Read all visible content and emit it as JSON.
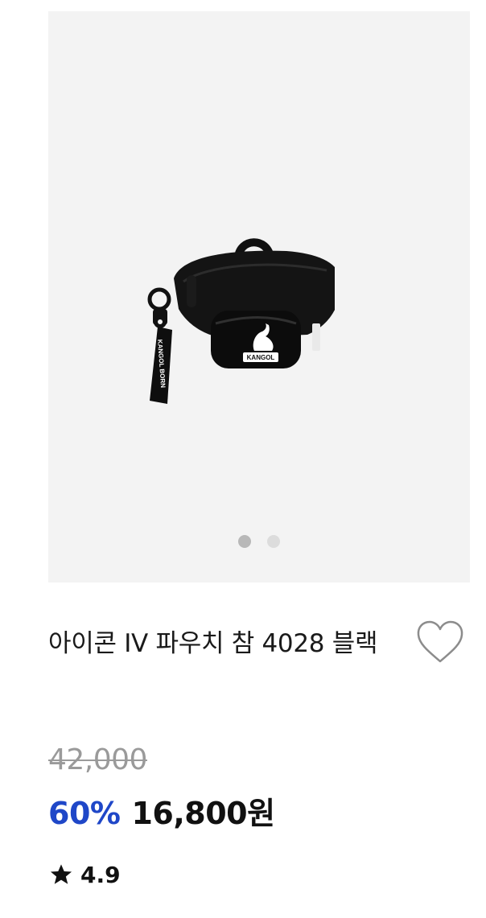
{
  "product": {
    "image": {
      "alt_icon": "kangol-waist-pouch-image",
      "logo_text": "KANGOL",
      "strap_text": "KANGOL BORN"
    },
    "carousel": {
      "count": 2,
      "active": 1
    },
    "title": "아이콘 IV 파우치 참 4028 블랙",
    "original_price": "42,000",
    "discount": "60%",
    "sale_price": "16,800원",
    "rating": "4.9",
    "icons": {
      "wishlist": "heart-outline-icon",
      "rating": "star-icon"
    },
    "colors": {
      "discount": "#1f47c8",
      "image_bg": "#f3f3f3",
      "dot_active": "#b8b8b8",
      "dot_inactive": "#dcdcdc",
      "strikethrough_price": "#9a9a9a"
    }
  }
}
